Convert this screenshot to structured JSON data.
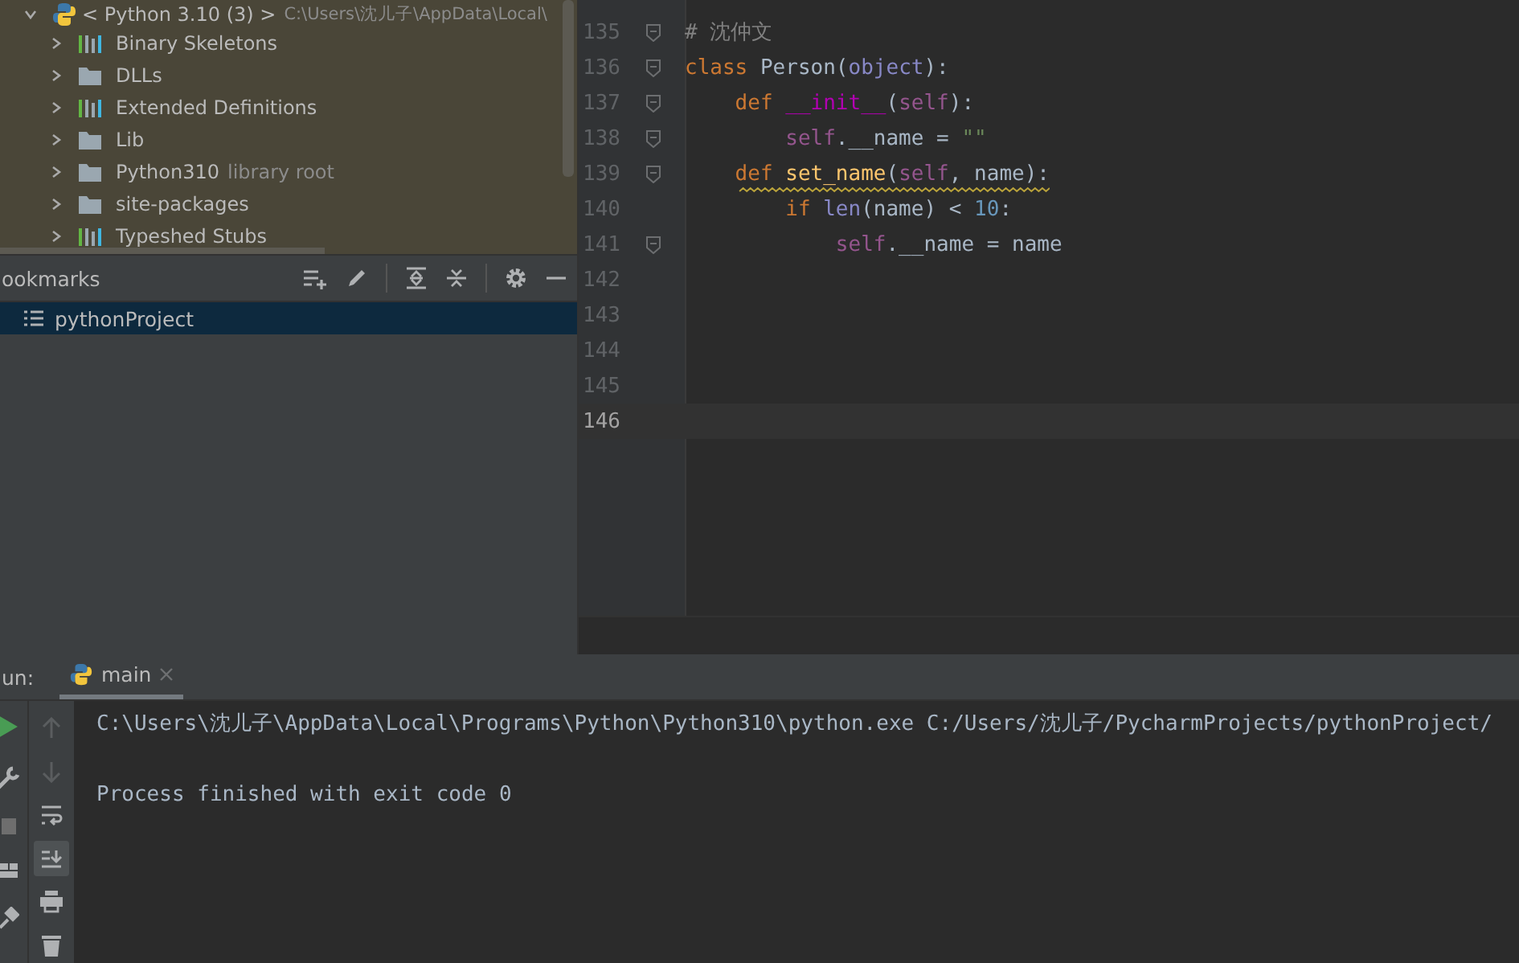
{
  "project_tree": {
    "root": {
      "label": "< Python 3.10 (3) >",
      "path": "C:\\Users\\沈儿子\\AppData\\Local\\",
      "expanded": true,
      "children": [
        {
          "label": "Binary Skeletons",
          "kind": "library",
          "expanded": false
        },
        {
          "label": "DLLs",
          "kind": "folder",
          "expanded": false
        },
        {
          "label": "Extended Definitions",
          "kind": "library",
          "expanded": false
        },
        {
          "label": "Lib",
          "kind": "folder",
          "expanded": false
        },
        {
          "label": "Python310",
          "hint": "library root",
          "kind": "folder",
          "expanded": false
        },
        {
          "label": "site-packages",
          "kind": "folder",
          "expanded": false
        },
        {
          "label": "Typeshed Stubs",
          "kind": "library",
          "expanded": false
        }
      ]
    }
  },
  "bookmarks": {
    "title": "ookmarks",
    "items": [
      {
        "label": "pythonProject",
        "selected": true
      }
    ]
  },
  "editor": {
    "lines": [
      {
        "number": "135",
        "fold": true,
        "current": false,
        "tokens": [
          {
            "text": "# 沈仲文",
            "kind": "comment"
          }
        ]
      },
      {
        "number": "136",
        "fold": true,
        "current": false,
        "tokens": [
          {
            "text": "class ",
            "kind": "keyword"
          },
          {
            "text": "Person(",
            "kind": "plain"
          },
          {
            "text": "object",
            "kind": "builtin"
          },
          {
            "text": "):",
            "kind": "plain"
          }
        ]
      },
      {
        "number": "137",
        "fold": true,
        "current": false,
        "tokens": [
          {
            "text": "    def ",
            "kind": "keyword"
          },
          {
            "text": "__init__",
            "kind": "magic"
          },
          {
            "text": "(",
            "kind": "plain"
          },
          {
            "text": "self",
            "kind": "self"
          },
          {
            "text": "):",
            "kind": "plain"
          }
        ]
      },
      {
        "number": "138",
        "fold": true,
        "current": false,
        "tokens": [
          {
            "text": "        self",
            "kind": "self"
          },
          {
            "text": ".__name = ",
            "kind": "plain"
          },
          {
            "text": "\"\"",
            "kind": "string"
          }
        ]
      },
      {
        "number": "139",
        "fold": true,
        "current": false,
        "warning": true,
        "tokens": [
          {
            "text": "    def ",
            "kind": "keyword"
          },
          {
            "text": "set_name",
            "kind": "function"
          },
          {
            "text": "(",
            "kind": "plain"
          },
          {
            "text": "self",
            "kind": "self"
          },
          {
            "text": ", name):",
            "kind": "plain"
          }
        ]
      },
      {
        "number": "140",
        "current": false,
        "tokens": [
          {
            "text": "        if ",
            "kind": "keyword"
          },
          {
            "text": "len",
            "kind": "builtin"
          },
          {
            "text": "(name) < ",
            "kind": "plain"
          },
          {
            "text": "10",
            "kind": "number"
          },
          {
            "text": ":",
            "kind": "plain"
          }
        ]
      },
      {
        "number": "141",
        "fold": true,
        "current": false,
        "tokens": [
          {
            "text": "            self",
            "kind": "self"
          },
          {
            "text": ".__name = name",
            "kind": "plain"
          }
        ]
      },
      {
        "number": "142",
        "current": false
      },
      {
        "number": "143",
        "current": false
      },
      {
        "number": "144",
        "current": false
      },
      {
        "number": "145",
        "current": false
      },
      {
        "number": "146",
        "current": true
      }
    ]
  },
  "run": {
    "label": "un:",
    "tabs": [
      {
        "label": "main",
        "selected": true
      }
    ],
    "left_tools": [
      {
        "kind": "run"
      },
      {
        "kind": "wrench"
      },
      {
        "kind": "stop"
      },
      {
        "kind": "layout"
      },
      {
        "kind": "pin"
      }
    ],
    "console_tools": [
      {
        "kind": "up",
        "disabled": true,
        "selected": false
      },
      {
        "kind": "down",
        "disabled": true,
        "selected": false
      },
      {
        "kind": "wrap",
        "disabled": false,
        "selected": false
      },
      {
        "kind": "scroll-end",
        "disabled": false,
        "selected": true
      },
      {
        "kind": "print",
        "disabled": false,
        "selected": false
      },
      {
        "kind": "trash",
        "disabled": false,
        "selected": false
      }
    ],
    "output": [
      "C:\\Users\\沈儿子\\AppData\\Local\\Programs\\Python\\Python310\\python.exe C:/Users/沈儿子/PycharmProjects/pythonProject/",
      "Process finished with exit code 0"
    ]
  }
}
